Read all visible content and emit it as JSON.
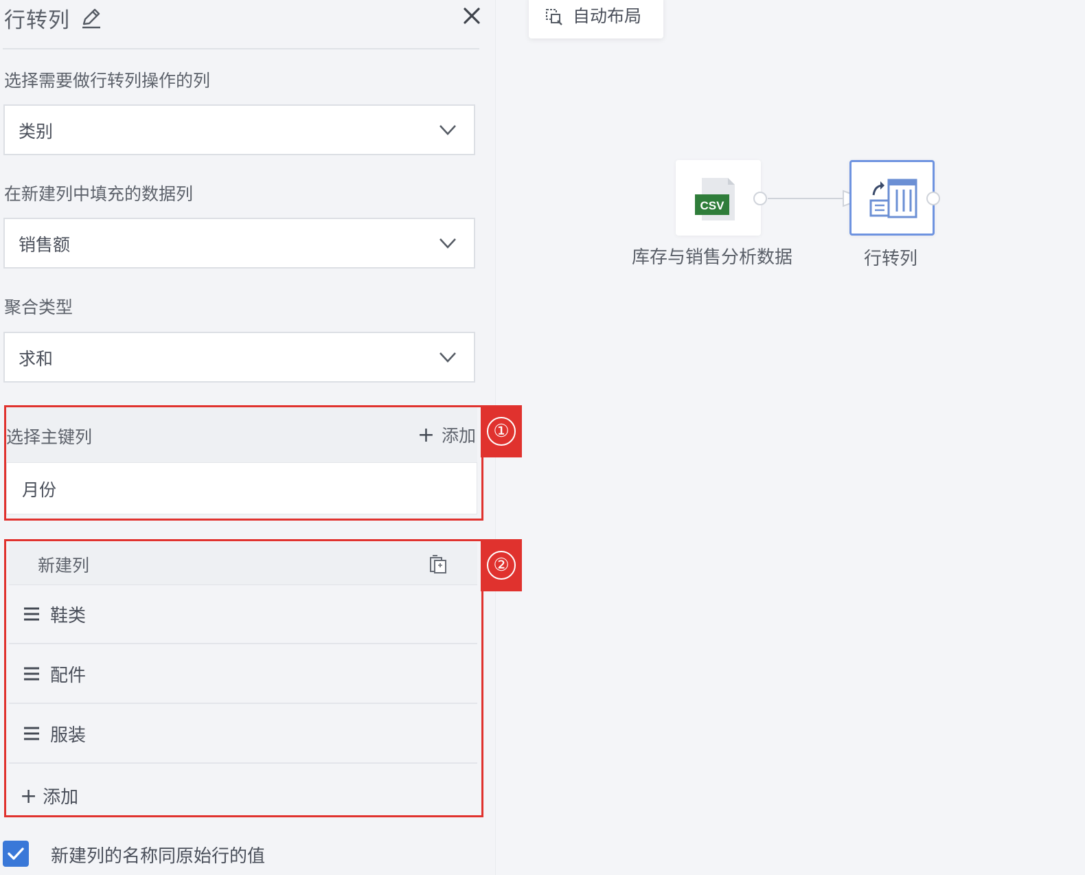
{
  "panel": {
    "title": "行转列",
    "fields": [
      {
        "label": "选择需要做行转列操作的列",
        "value": "类别"
      },
      {
        "label": "在新建列中填充的数据列",
        "value": "销售额"
      },
      {
        "label": "聚合类型",
        "value": "求和"
      }
    ],
    "primary_key": {
      "label": "选择主键列",
      "add_label": "添加",
      "value": "月份",
      "badge": "①"
    },
    "new_columns": {
      "title": "新建列",
      "items": [
        "鞋类",
        "配件",
        "服装"
      ],
      "add_label": "添加",
      "badge": "②"
    },
    "checkbox": {
      "label": "新建列的名称同原始行的值",
      "checked": true
    }
  },
  "canvas": {
    "auto_layout_label": "自动布局",
    "nodes": [
      {
        "label": "库存与销售分析数据",
        "icon": "csv-file-icon",
        "icon_text": "CSV"
      },
      {
        "label": "行转列",
        "icon": "row-to-column-icon",
        "selected": true
      }
    ]
  },
  "colors": {
    "highlight_red": "#e0322e",
    "accent_blue": "#3a78d8",
    "csv_green": "#2f7d3a"
  }
}
